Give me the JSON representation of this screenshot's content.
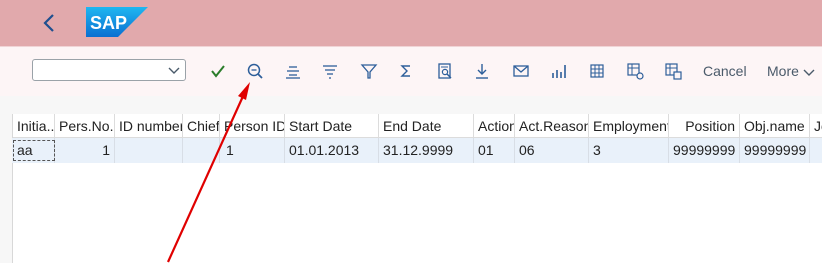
{
  "header": {
    "logo_text": "SAP"
  },
  "toolbar": {
    "variant_value": "",
    "icons": [
      {
        "name": "checkmark-icon",
        "color": "#2b7d2b"
      },
      {
        "name": "zoom-search-icon"
      },
      {
        "name": "center-align-icon"
      },
      {
        "name": "sort-lines-icon"
      },
      {
        "name": "filter-icon"
      },
      {
        "name": "sum-icon"
      },
      {
        "name": "print-preview-icon"
      },
      {
        "name": "download-icon"
      },
      {
        "name": "mail-icon"
      },
      {
        "name": "chart-icon"
      },
      {
        "name": "table-layout-icon"
      },
      {
        "name": "table-settings-icon"
      },
      {
        "name": "table-select-icon"
      }
    ],
    "cancel_label": "Cancel",
    "more_label": "More"
  },
  "table": {
    "columns": [
      "Initia...",
      "Pers.No.",
      "ID number",
      "Chief",
      "Person ID",
      "Start Date",
      "End Date",
      "Action",
      "Act.Reason",
      "Employment",
      "Position",
      "Obj.name",
      "Jo"
    ],
    "rows": [
      [
        "aa",
        "1",
        "",
        "",
        "1",
        "01.01.2013",
        "31.12.9999",
        "01",
        "06",
        "3",
        "99999999",
        "99999999",
        ""
      ]
    ]
  },
  "colors": {
    "shell_bg": "#e1a9ac",
    "toolbar_bg": "#fdf5f6",
    "row_selected": "#e9f1fa",
    "annotation_arrow": "#e00000"
  }
}
